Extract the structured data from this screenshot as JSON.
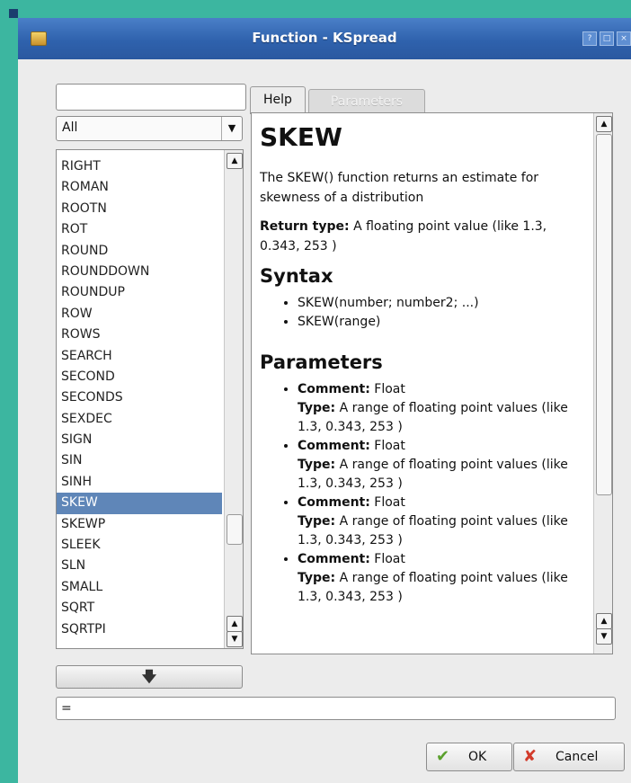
{
  "window": {
    "title": "Function - KSpread"
  },
  "search": {
    "value": ""
  },
  "category": {
    "selected": "All"
  },
  "function_list": {
    "items": [
      "RIGHT",
      "ROMAN",
      "ROOTN",
      "ROT",
      "ROUND",
      "ROUNDDOWN",
      "ROUNDUP",
      "ROW",
      "ROWS",
      "SEARCH",
      "SECOND",
      "SECONDS",
      "SEXDEC",
      "SIGN",
      "SIN",
      "SINH",
      "SKEW",
      "SKEWP",
      "SLEEK",
      "SLN",
      "SMALL",
      "SQRT",
      "SQRTPI"
    ],
    "selected": "SKEW"
  },
  "tabs": {
    "help": "Help",
    "parameters": "Parameters"
  },
  "help": {
    "title": "SKEW",
    "description": "The SKEW() function returns an estimate for skewness of a distribution",
    "return_label": "Return type:",
    "return_text": "A floating point value (like 1.3, 0.343, 253 )",
    "syntax_heading": "Syntax",
    "syntax": [
      "SKEW(number; number2; ...)",
      "SKEW(range)"
    ],
    "params_heading": "Parameters",
    "params": [
      {
        "comment_label": "Comment:",
        "comment": "Float",
        "type_label": "Type:",
        "type": "A range of floating point values (like 1.3, 0.343, 253 )"
      },
      {
        "comment_label": "Comment:",
        "comment": "Float",
        "type_label": "Type:",
        "type": "A range of floating point values (like 1.3, 0.343, 253 )"
      },
      {
        "comment_label": "Comment:",
        "comment": "Float",
        "type_label": "Type:",
        "type": "A range of floating point values (like 1.3, 0.343, 253 )"
      },
      {
        "comment_label": "Comment:",
        "comment": "Float",
        "type_label": "Type:",
        "type": "A range of floating point values (like 1.3, 0.343, 253 )"
      }
    ]
  },
  "formula": {
    "value": "="
  },
  "buttons": {
    "ok": "OK",
    "cancel": "Cancel"
  },
  "icons": {
    "insert": "arrow-down-icon",
    "ok": "checkmark-icon",
    "cancel": "x-icon",
    "app": "kspread-icon",
    "titlebar": [
      "help-icon",
      "maximize-icon",
      "close-icon"
    ]
  },
  "colors": {
    "titlebar": "#2f62ad",
    "selection": "#5f86b8",
    "ok_icon": "#5aa02c",
    "cancel_icon": "#d23b2b"
  }
}
